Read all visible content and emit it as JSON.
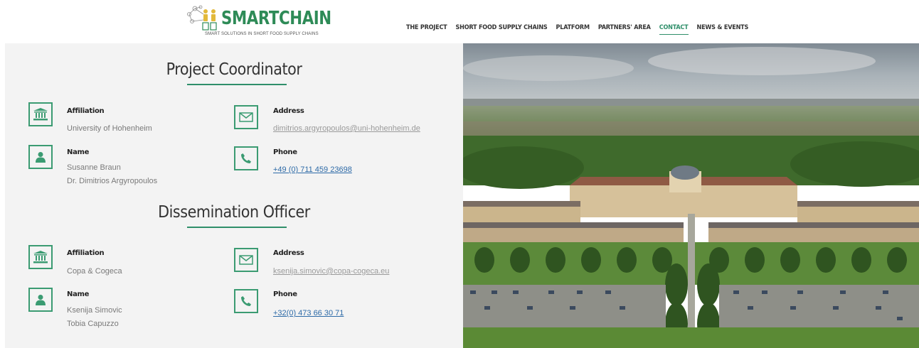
{
  "header": {
    "logo_text": "SMARTCHAIN",
    "logo_tagline": "SMART SOLUTIONS IN SHORT FOOD SUPPLY CHAINS",
    "nav": [
      {
        "label": "THE PROJECT",
        "active": false
      },
      {
        "label": "SHORT FOOD SUPPLY CHAINS",
        "active": false
      },
      {
        "label": "PLATFORM",
        "active": false
      },
      {
        "label": "PARTNERS' AREA",
        "active": false
      },
      {
        "label": "CONTACT",
        "active": true
      },
      {
        "label": "NEWS & EVENTS",
        "active": false
      }
    ]
  },
  "coordinator": {
    "title": "Project Coordinator",
    "affiliation_label": "Affiliation",
    "affiliation_value": "University of Hohenheim",
    "name_label": "Name",
    "name_1": "Susanne Braun",
    "name_2": "Dr. Dimitrios Argyropoulos",
    "address_label": "Address",
    "address_value": "dimitrios.argyropoulos@uni-hohenheim.de",
    "phone_label": "Phone",
    "phone_value": "+49 (0) 711 459 23698"
  },
  "dissemination": {
    "title": "Dissemination Officer",
    "affiliation_label": "Affiliation",
    "affiliation_value": "Copa & Cogeca",
    "name_label": "Name",
    "name_1": "Ksenija Simovic",
    "name_2": "Tobia Capuzzo",
    "address_label": "Address",
    "address_value": "ksenija.simovic@copa-cogeca.eu",
    "phone_label": "Phone",
    "phone_value": "+32(0) 473 66 30 71"
  },
  "colors": {
    "accent": "#2f8f6a",
    "link": "#2d6aa7"
  },
  "icons": {
    "affiliation": "building-icon",
    "name": "person-icon",
    "address": "envelope-icon",
    "phone": "phone-icon"
  }
}
